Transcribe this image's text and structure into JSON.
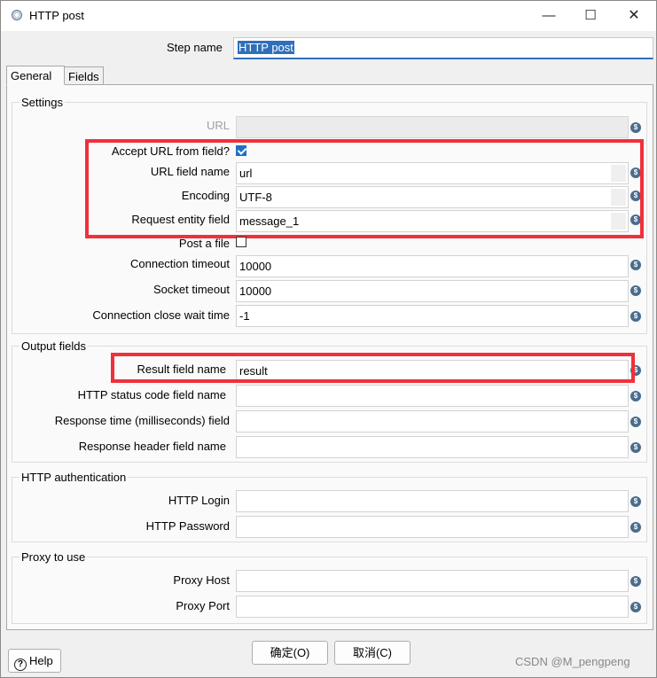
{
  "window": {
    "title": "HTTP post",
    "minimize_glyph": "—",
    "maximize_glyph": "☐",
    "close_glyph": "✕"
  },
  "step": {
    "label": "Step name",
    "value": "HTTP post"
  },
  "tabs": [
    {
      "label": "General"
    },
    {
      "label": "Fields"
    }
  ],
  "settings": {
    "title": "Settings",
    "url_label": "URL",
    "url_value": "",
    "accept_url_label": "Accept URL from field?",
    "accept_url_checked": true,
    "url_field_label": "URL field name",
    "url_field_value": "url",
    "encoding_label": "Encoding",
    "encoding_value": "UTF-8",
    "request_entity_label": "Request entity field",
    "request_entity_value": "message_1",
    "post_file_label": "Post a file",
    "post_file_checked": false,
    "conn_timeout_label": "Connection timeout",
    "conn_timeout_value": "10000",
    "socket_timeout_label": "Socket timeout",
    "socket_timeout_value": "10000",
    "close_wait_label": "Connection close wait time",
    "close_wait_value": "-1"
  },
  "output": {
    "title": "Output fields",
    "result_label": "Result field name",
    "result_value": "result",
    "status_label": "HTTP status code field name",
    "status_value": "",
    "response_time_label": "Response time (milliseconds) field",
    "response_time_value": "",
    "response_header_label": "Response header field name",
    "response_header_value": ""
  },
  "auth": {
    "title": "HTTP authentication",
    "login_label": "HTTP Login",
    "login_value": "",
    "password_label": "HTTP Password",
    "password_value": ""
  },
  "proxy": {
    "title": "Proxy to use",
    "host_label": "Proxy Host",
    "host_value": "",
    "port_label": "Proxy Port",
    "port_value": ""
  },
  "buttons": {
    "help": "Help",
    "ok": "确定(O)",
    "cancel": "取消(C)"
  },
  "watermark": "CSDN @M_pengpeng",
  "colors": {
    "accent": "#2f6fba",
    "highlight": "#f0303a",
    "variable_icon": "#4a6c8e"
  },
  "icons": {
    "variable": "$"
  }
}
